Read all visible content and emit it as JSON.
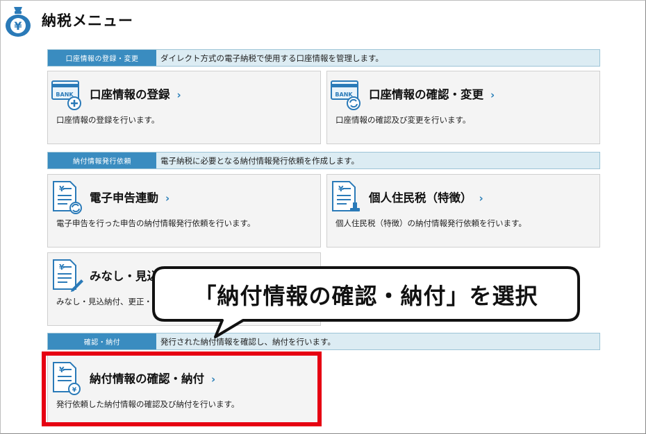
{
  "header": {
    "title": "納税メニュー",
    "icon": "yen-money-bag-icon"
  },
  "sections": {
    "account": {
      "label": "口座情報の登録・変更",
      "description": "ダイレクト方式の電子納税で使用する口座情報を管理します。"
    },
    "request": {
      "label": "納付情報発行依頼",
      "description": "電子納税に必要となる納付情報発行依頼を作成します。"
    },
    "confirm": {
      "label": "確認・納付",
      "description": "発行された納付情報を確認し、納付を行います。"
    }
  },
  "cards": {
    "register_account": {
      "title": "口座情報の登録",
      "chevron": "›",
      "description": "口座情報の登録を行います。",
      "icon": "bank-card-add-icon",
      "icon_text": "BANK"
    },
    "change_account": {
      "title": "口座情報の確認・変更",
      "chevron": "›",
      "description": "口座情報の確認及び変更を行います。",
      "icon": "bank-card-refresh-icon",
      "icon_text": "BANK"
    },
    "e_filing": {
      "title": "電子申告連動",
      "chevron": "›",
      "description": "電子申告を行った申告の納付情報発行依頼を行います。",
      "icon": "yen-document-refresh-icon",
      "icon_text": "¥"
    },
    "resident_tax": {
      "title": "個人住民税（特徴）",
      "chevron": "›",
      "description": "個人住民税（特徴）の納付情報発行依頼を行います。",
      "icon": "yen-document-stamp-icon",
      "icon_text": "¥"
    },
    "estimated": {
      "title": "みなし・見込",
      "description": "みなし・見込納付、更正・",
      "icon": "yen-document-pencil-icon",
      "icon_text": "¥"
    },
    "confirm_payment": {
      "title": "納付情報の確認・納付",
      "chevron": "›",
      "description": "発行依頼した納付情報の確認及び納付を行います。",
      "icon": "yen-document-coin-icon",
      "icon_text": "¥"
    }
  },
  "callout": {
    "text": "「納付情報の確認・納付」を選択"
  },
  "colors": {
    "section_label_bg": "#3a8cc0",
    "section_bar_bg": "#dcecf3",
    "accent_chevron": "#2a7fb8",
    "highlight": "#e60012",
    "card_bg": "#f4f4f4"
  }
}
